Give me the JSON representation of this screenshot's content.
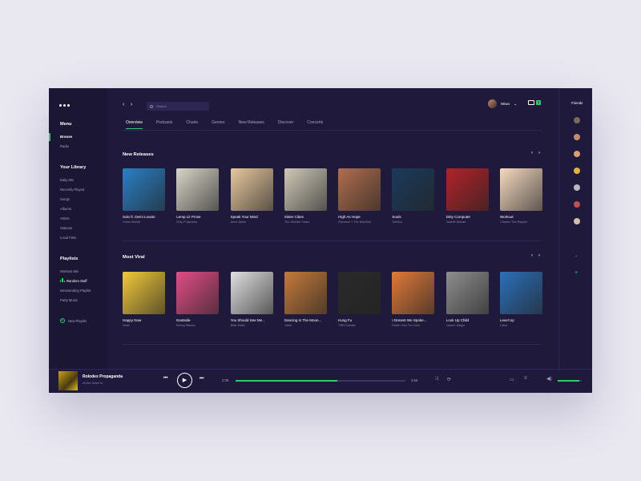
{
  "sidebar": {
    "menu_title": "Menu",
    "menu_items": [
      "Browse",
      "Radio"
    ],
    "library_title": "Your Library",
    "library_items": [
      "Daily Mix",
      "Recently Played",
      "Songs",
      "Albums",
      "Artists",
      "Stations",
      "Local Files"
    ],
    "playlists_title": "Playlists",
    "playlists": [
      "Workout Mix",
      "Random Stuff",
      "Neverending Playlist",
      "Party Music"
    ],
    "new_playlist": "New Playlist"
  },
  "header": {
    "search_placeholder": "Search",
    "user_name": "Wiwo",
    "mail_count": "3"
  },
  "tabs": [
    "Overview",
    "Podcasts",
    "Charts",
    "Genres",
    "New Releases",
    "Discover",
    "Concerts"
  ],
  "new_releases": {
    "title": "New Releases",
    "albums": [
      {
        "title": "Solo ft. Demi Lovato",
        "artist": "Clean Bandit",
        "color": "#2a7fc5"
      },
      {
        "title": "Lemp Lit Prose",
        "artist": "Dirty Projectors",
        "color": "#d8d4c8"
      },
      {
        "title": "Speak Your Mind",
        "artist": "Anne-Marie",
        "color": "#e6c89e"
      },
      {
        "title": "Sister Cities",
        "artist": "The Wonder Years",
        "color": "#cfc9b8"
      },
      {
        "title": "High As Hope",
        "artist": "Florence + The Machine",
        "color": "#b06e4e"
      },
      {
        "title": "Souls",
        "artist": "Shellco",
        "color": "#1c3a5c"
      },
      {
        "title": "Dirty Computer",
        "artist": "Janelle Monáe",
        "color": "#b0232a"
      },
      {
        "title": "Workout",
        "artist": "Chance The Rapper",
        "color": "#f5d9c0"
      }
    ]
  },
  "most_viral": {
    "title": "Most Viral",
    "albums": [
      {
        "title": "Happy Now",
        "artist": "Zedd",
        "color": "#f2c93a"
      },
      {
        "title": "Eastside",
        "artist": "Benny Blanco",
        "color": "#e04d86"
      },
      {
        "title": "You Should See Me...",
        "artist": "Billie Eilish",
        "color": "#e0e0e0"
      },
      {
        "title": "Dancing in The Moon...",
        "artist": "Jubel",
        "color": "#c47a3a"
      },
      {
        "title": "Kung Fu",
        "artist": "YRN Cordae",
        "color": "#2a2a2a"
      },
      {
        "title": "I Dreamt We Spoke...",
        "artist": "Death Cab For Cutie",
        "color": "#e07a3a"
      },
      {
        "title": "Look Up Child",
        "artist": "Lauren Daigle",
        "color": "#8e8e8e"
      },
      {
        "title": "Level Up",
        "artist": "Ciara",
        "color": "#2c6fb8"
      }
    ]
  },
  "friends": {
    "title": "Friends",
    "avatar_colors": [
      "#7a6a5a",
      "#c48a6a",
      "#d8a06a",
      "#e0b040",
      "#b8b8c0",
      "#c05050",
      "#d0c0b0"
    ]
  },
  "player": {
    "track": "Rolodex Propaganda",
    "artist": "At the Drive In",
    "elapsed": "2:09",
    "duration": "3:56",
    "progress_pct": 60,
    "volume_pct": 90
  },
  "colors": {
    "accent": "#2ecc71",
    "bg": "#1f1a3c",
    "sidebar": "#1a1633"
  },
  "icons": [
    "dots-menu-icon",
    "chevron-left-icon",
    "chevron-right-icon",
    "search-icon",
    "mail-icon",
    "previous-icon",
    "play-icon",
    "next-icon",
    "shuffle-icon",
    "repeat-icon",
    "devices-icon",
    "queue-icon",
    "volume-icon"
  ]
}
